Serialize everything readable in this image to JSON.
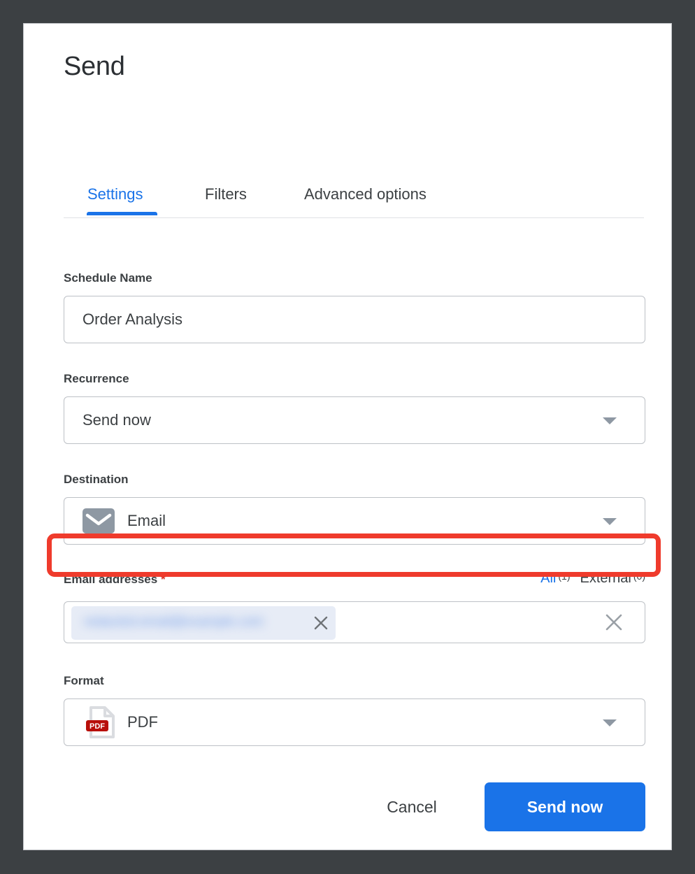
{
  "dialog": {
    "title": "Send"
  },
  "tabs": [
    {
      "label": "Settings",
      "active": true
    },
    {
      "label": "Filters",
      "active": false
    },
    {
      "label": "Advanced options",
      "active": false
    }
  ],
  "form": {
    "schedule_name": {
      "label": "Schedule Name",
      "value": "Order Analysis"
    },
    "recurrence": {
      "label": "Recurrence",
      "value": "Send now"
    },
    "destination": {
      "label": "Destination",
      "value": "Email",
      "icon": "envelope-icon"
    },
    "email_addresses": {
      "label": "Email addresses",
      "required_marker": "*",
      "toggle": {
        "all_label": "All",
        "all_count": "(1)",
        "external_label": "External",
        "external_count": "(0)"
      },
      "chips": [
        {
          "text": "redacted.email@example.com",
          "redacted": true,
          "remove_icon": "close-icon"
        }
      ],
      "clear_icon": "close-icon"
    },
    "format": {
      "label": "Format",
      "value": "PDF",
      "icon": "pdf-file-icon"
    }
  },
  "footer": {
    "cancel_label": "Cancel",
    "send_label": "Send now"
  },
  "colors": {
    "accent": "#1a73e8",
    "highlight": "#ef3b2c",
    "required": "#d93025",
    "backdrop": "#3c4043",
    "pdf_badge": "#b80f0a"
  }
}
